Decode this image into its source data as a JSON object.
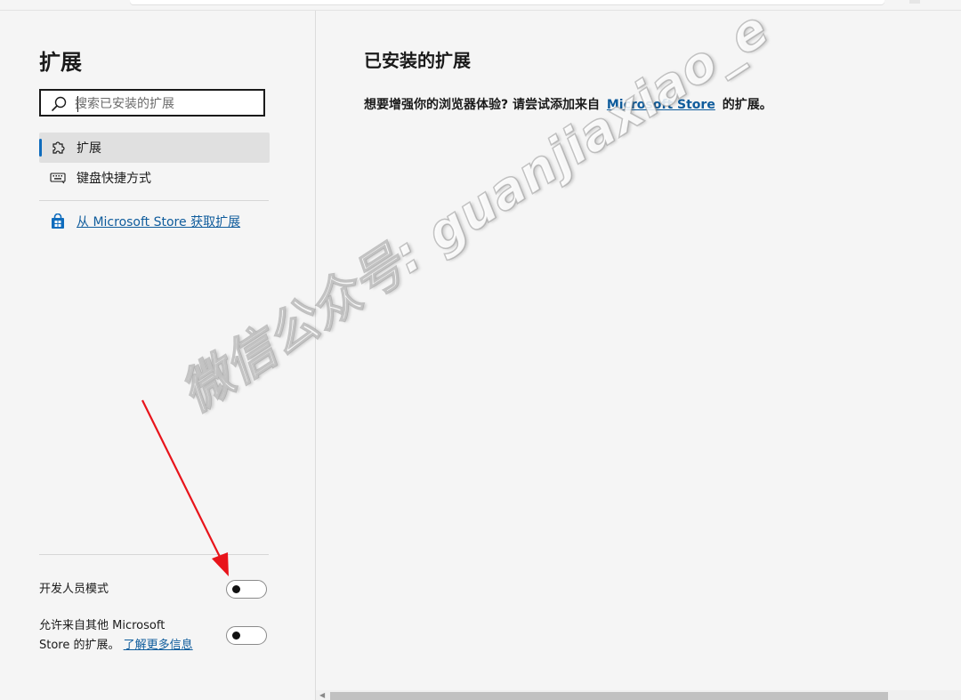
{
  "sidebar": {
    "title": "扩展",
    "search_placeholder": "搜索已安装的扩展",
    "nav": [
      {
        "label": "扩展",
        "icon": "puzzle-icon",
        "active": true
      },
      {
        "label": "键盘快捷方式",
        "icon": "keyboard-icon",
        "active": false
      }
    ],
    "store_link": {
      "label": "从 Microsoft Store 获取扩展",
      "icon": "store-bag-icon"
    },
    "settings": {
      "developer_mode": {
        "label": "开发人员模式",
        "enabled": false
      },
      "allow_other_stores": {
        "line1": "允许来自其他 Microsoft",
        "line2": "Store 的扩展。",
        "link": "了解更多信息",
        "enabled": false
      }
    }
  },
  "main": {
    "title": "已安装的扩展",
    "message_prefix": "想要增强你的浏览器体验? 请尝试添加来自",
    "message_link": "Microsoft Store",
    "message_suffix": "的扩展。"
  },
  "watermark": "微信公众号: guanjiaxiao_e",
  "colors": {
    "accent": "#0f6cbd",
    "link": "#0f5c9c",
    "annotation_arrow": "#e8141b"
  }
}
